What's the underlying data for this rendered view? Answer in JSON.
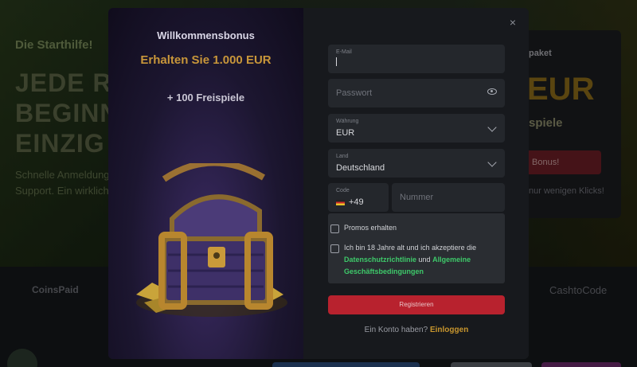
{
  "background": {
    "left_title": "Die Starthilfe!",
    "left_big_lines": [
      "JEDE R",
      "BEGINN",
      "EINZIG"
    ],
    "left_desc_lines": [
      "Schnelle Anmeldung",
      "Support. Ein wirklich"
    ],
    "right_label": "paket",
    "right_big": "EUR",
    "right_sub": "spiele",
    "right_button": "Bonus!",
    "right_note": "nur wenigen Klicks!",
    "logo_left": "CoinsPaid",
    "logo_right": "CashtoCode"
  },
  "promo": {
    "title": "Willkommensbonus",
    "amount": "Erhalten Sie 1.000 EUR",
    "spins": "+ 100 Freispiele",
    "icons": {
      "chest": "treasure-chest-icon"
    }
  },
  "form": {
    "close_label": "×",
    "email": {
      "label": "E-Mail",
      "value": ""
    },
    "password": {
      "placeholder": "Passwort"
    },
    "currency": {
      "label": "Währung",
      "value": "EUR"
    },
    "country": {
      "label": "Land",
      "value": "Deutschland"
    },
    "phone": {
      "code_label": "Code",
      "code_value": "+49",
      "number_placeholder": "Nummer"
    },
    "promos_label": "Promos erhalten",
    "terms": {
      "prefix": "Ich bin 18 Jahre alt und ich akzeptiere die",
      "privacy_link": "Datenschutzrichtlinie",
      "and": "und",
      "terms_link": "Allgemeine Geschäftsbedingungen"
    },
    "register_label": "Registrieren",
    "have_account": "Ein Konto haben?",
    "login_link": "Einloggen"
  },
  "colors": {
    "accent_red": "#b8222e",
    "link_green": "#3ec96a",
    "gold": "#c8963a"
  }
}
